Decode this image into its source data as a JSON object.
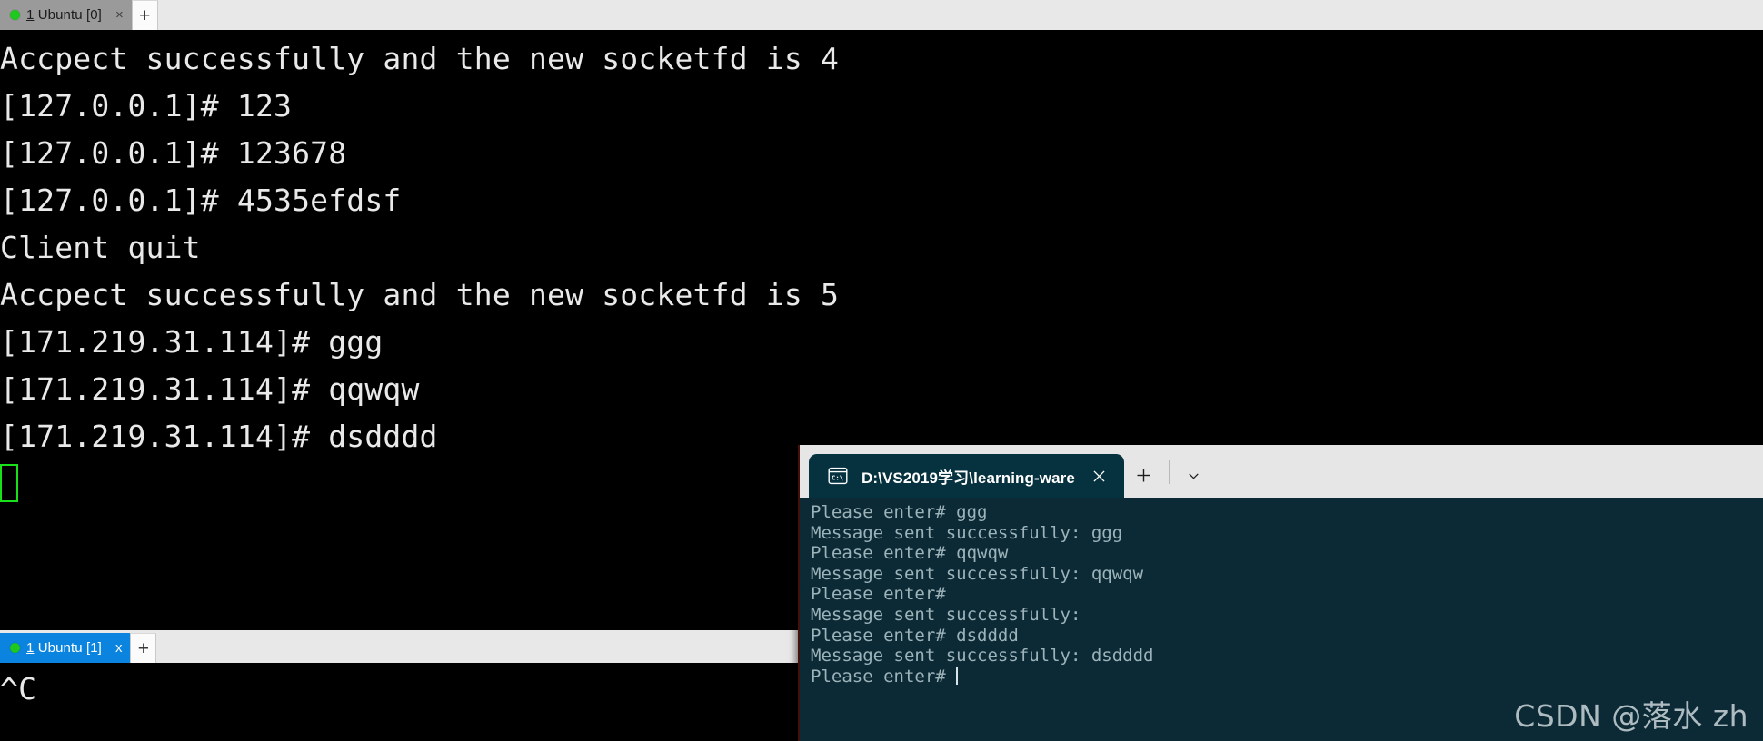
{
  "outer_terminal": {
    "app": "ssh-terminal",
    "background_color": "#000000",
    "foreground_color": "#e9e9e9",
    "tabstrip_top": {
      "tab": {
        "label_prefix": "1",
        "label_rest": " Ubuntu [0]",
        "full_label": "1 Ubuntu [0]",
        "status": "connected",
        "status_color": "#1ec81e",
        "close_glyph": "×",
        "state": "inactive"
      },
      "new_tab_glyph": "+"
    },
    "tabstrip_bottom": {
      "tab": {
        "label_prefix": "1",
        "label_rest": " Ubuntu [1]",
        "full_label": "1 Ubuntu [1]",
        "status": "connected",
        "status_color": "#1ec81e",
        "close_glyph": "x",
        "state": "active",
        "active_color": "#0b84e0"
      },
      "new_tab_glyph": "+"
    },
    "session0_lines": [
      "Accpect successfully and the new socketfd is 4",
      "[127.0.0.1]# 123",
      "[127.0.0.1]# 123678",
      "[127.0.0.1]# 4535efdsf",
      "Client quit",
      "Accpect successfully and the new socketfd is 5",
      "[171.219.31.114]# ggg",
      "[171.219.31.114]# qqwqw",
      "[171.219.31.114]# dsdddd"
    ],
    "session0_cursor": {
      "type": "hollow-block",
      "color": "#19e019"
    },
    "session1_lines": [
      "^C"
    ]
  },
  "windows_terminal": {
    "app": "windows-terminal",
    "background_color": "#0c2a35",
    "tab": {
      "title": "D:\\VS2019学习\\learning-ware",
      "icon": "cmd-console-icon",
      "icon_text": "C:\\",
      "close_glyph": "✕",
      "tab_color": "#06313f"
    },
    "controls": {
      "new_tab_glyph": "+",
      "dropdown_glyph": "⌄"
    },
    "lines": [
      "Please enter# ggg",
      "Message sent successfully: ggg",
      "Please enter# qqwqw",
      "Message sent successfully: qqwqw",
      "Please enter#",
      "Message sent successfully:",
      "Please enter# dsdddd",
      "Message sent successfully: dsdddd"
    ],
    "prompt_line": "Please enter# "
  },
  "watermark": {
    "text": "CSDN @落水 zh"
  }
}
